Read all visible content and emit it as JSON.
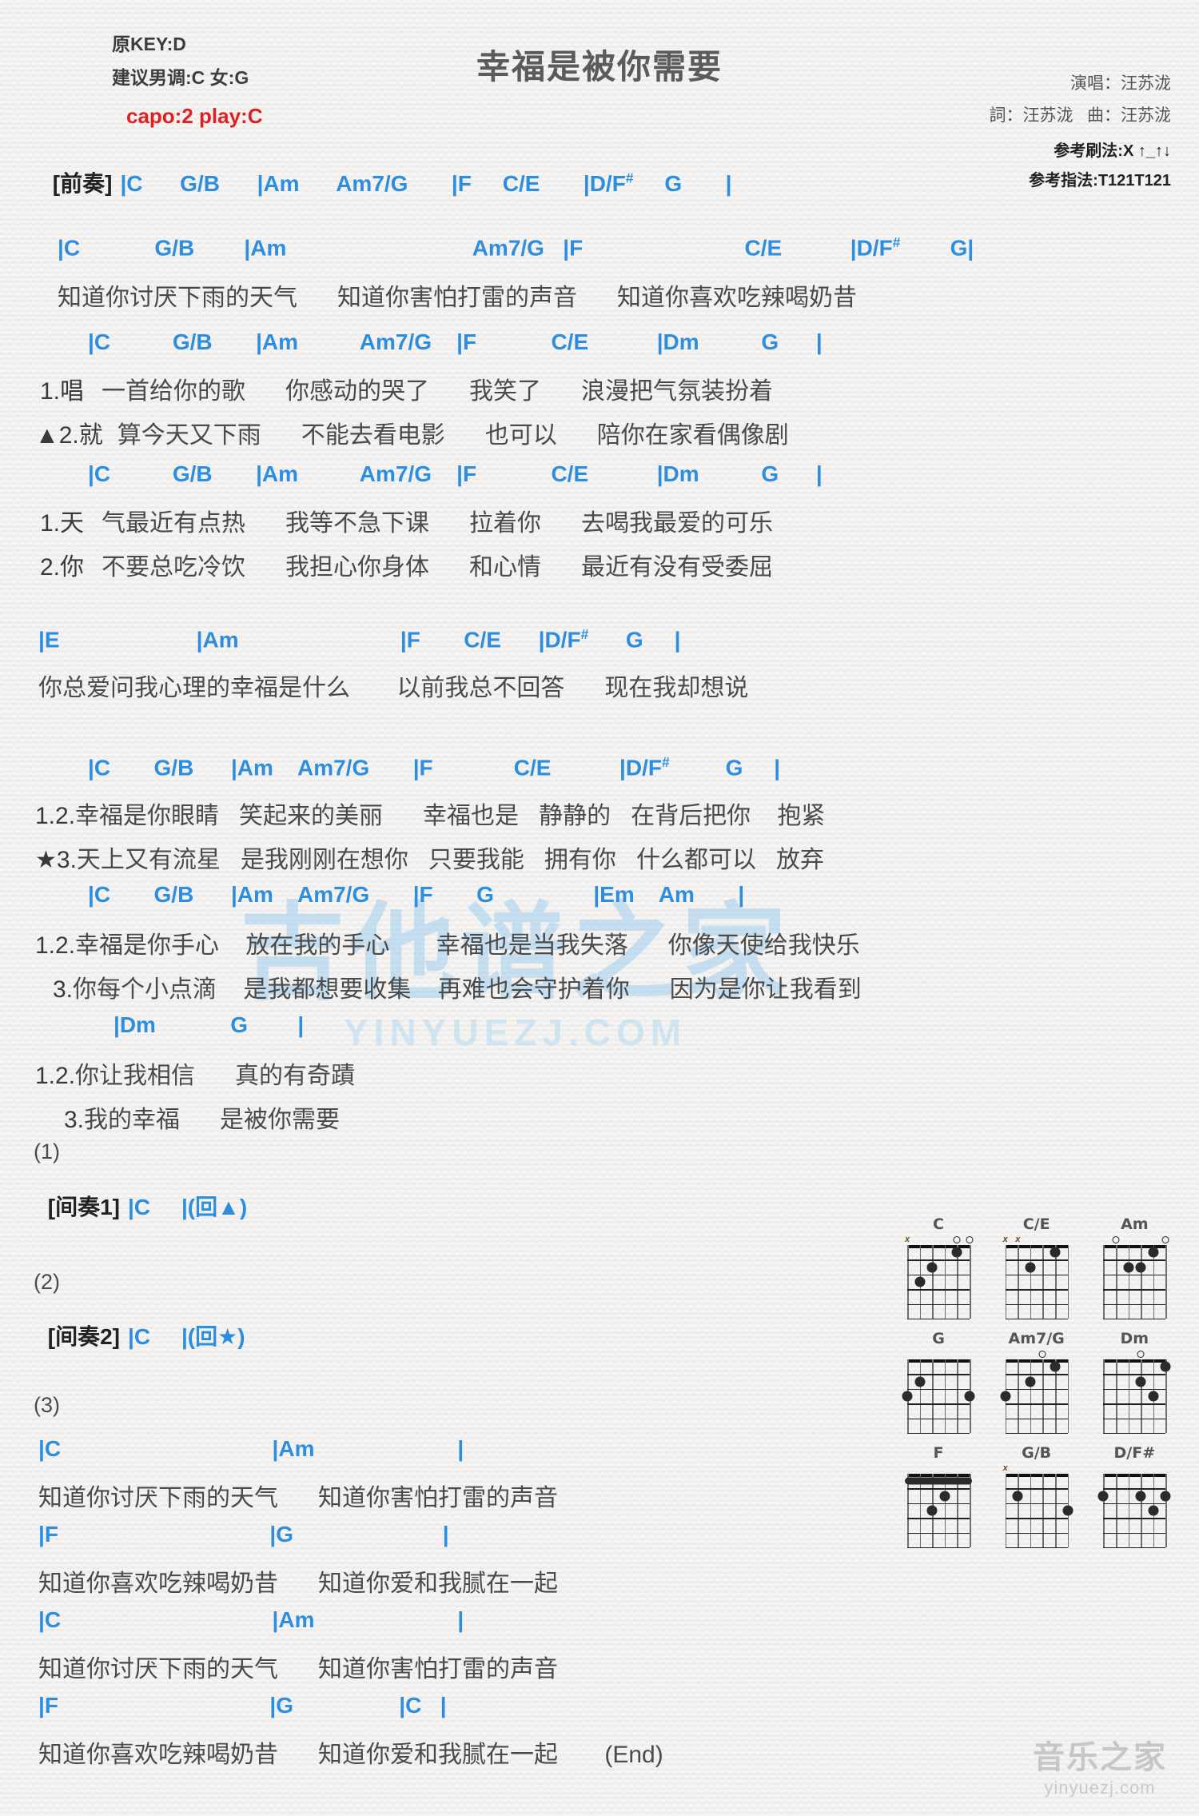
{
  "header": {
    "title": "幸福是被你需要",
    "original_key": "原KEY:D",
    "suggested_key": "建议男调:C 女:G",
    "capo": "capo:2 play:C",
    "singer": "演唱：汪苏泷",
    "writer": "詞：汪苏泷   曲：汪苏泷",
    "strumming": "参考刷法:X ↑_↑↓",
    "fingering": "参考指法:T121T121",
    "colors": {
      "chord": "#2d8ddf",
      "accent_red": "#e02020",
      "lyric": "#4a4a4a"
    }
  },
  "prelude": {
    "label": "[前奏]",
    "chords": "|C      G/B      |Am      Am7/G       |F     C/E       |D/F#     G       |"
  },
  "sections": [
    {
      "name": "verse-intro",
      "chord_line": "|C            G/B        |Am                              Am7/G   |F                          C/E           |D/F#        G|",
      "lyric_lines": [
        {
          "prefix": "",
          "text": "知道你讨厌下雨的天气      知道你害怕打雷的声音      知道你喜欢吃辣喝奶昔"
        }
      ]
    },
    {
      "name": "verse-1a",
      "chord_line": "|C          G/B       |Am          Am7/G    |F            C/E           |Dm          G      |",
      "lyric_lines": [
        {
          "prefix": "1.唱",
          "text": "一首给你的歌      你感动的哭了      我笑了      浪漫把气氛装扮着"
        },
        {
          "prefix": "▲2.就",
          "text": "算今天又下雨      不能去看电影      也可以      陪你在家看偶像剧"
        }
      ]
    },
    {
      "name": "verse-1b",
      "chord_line": "|C          G/B       |Am          Am7/G    |F            C/E           |Dm          G      |",
      "lyric_lines": [
        {
          "prefix": "1.天",
          "text": "气最近有点热      我等不急下课      拉着你      去喝我最爱的可乐"
        },
        {
          "prefix": "2.你",
          "text": "不要总吃冷饮      我担心你身体      和心情      最近有没有受委屈"
        }
      ]
    },
    {
      "name": "pre-chorus",
      "chord_line": "|E                      |Am                          |F       C/E      |D/F#      G     |",
      "lyric_lines": [
        {
          "prefix": "",
          "text": "你总爱问我心理的幸福是什么       以前我总不回答      现在我却想说"
        }
      ]
    },
    {
      "name": "chorus-1",
      "chord_line": "|C       G/B      |Am    Am7/G       |F             C/E           |D/F#         G     |",
      "lyric_lines": [
        {
          "prefix": "1.2.",
          "text": "幸福是你眼睛   笑起来的美丽      幸福也是   静静的   在背后把你    抱紧"
        },
        {
          "prefix": "★3.",
          "text": "天上又有流星   是我刚刚在想你   只要我能   拥有你   什么都可以   放弃"
        }
      ]
    },
    {
      "name": "chorus-2",
      "chord_line": "|C       G/B      |Am    Am7/G       |F       G                |Em    Am       |",
      "lyric_lines": [
        {
          "prefix": "1.2.",
          "text": "幸福是你手心    放在我的手心       幸福也是当我失落      你像天使给我快乐"
        },
        {
          "prefix": "3.",
          "text": "你每个小点滴    是我都想要收集    再难也会守护着你      因为是你让我看到"
        }
      ]
    },
    {
      "name": "chorus-tag",
      "chord_line": "|Dm            G        |",
      "lyric_lines": [
        {
          "prefix": "1.2.",
          "text": "你让我相信      真的有奇蹟"
        },
        {
          "prefix": "3.",
          "text": "我的幸福      是被你需要"
        }
      ]
    }
  ],
  "interludes": [
    {
      "marker": "(1)",
      "label": "[间奏1]",
      "chords": "|C     |(回▲)"
    },
    {
      "marker": "(2)",
      "label": "[间奏2]",
      "chords": "|C     |(回★)"
    },
    {
      "marker": "(3)",
      "label": "",
      "chords": ""
    }
  ],
  "outro": [
    {
      "chord_line": "|C                                  |Am                       |",
      "lyric": "知道你讨厌下雨的天气      知道你害怕打雷的声音"
    },
    {
      "chord_line": "|F                                  |G                        |",
      "lyric": "知道你喜欢吃辣喝奶昔      知道你爱和我腻在一起"
    },
    {
      "chord_line": "|C                                  |Am                       |",
      "lyric": "知道你讨厌下雨的天气      知道你害怕打雷的声音"
    },
    {
      "chord_line": "|F                                  |G                 |C   |",
      "lyric": "知道你喜欢吃辣喝奶昔      知道你爱和我腻在一起       (End)"
    }
  ],
  "chord_diagrams": [
    {
      "name": "C",
      "markers": [
        "x",
        "",
        "",
        "",
        "o",
        "o"
      ],
      "dots": [
        [
          5,
          3
        ],
        [
          4,
          2
        ],
        [
          2,
          1
        ]
      ],
      "barre": null
    },
    {
      "name": "C/E",
      "markers": [
        "x",
        "x",
        "",
        "",
        "",
        ""
      ],
      "dots": [
        [
          4,
          2
        ],
        [
          2,
          1
        ]
      ],
      "barre": null
    },
    {
      "name": "Am",
      "markers": [
        "",
        "o",
        "",
        "",
        "",
        "o"
      ],
      "dots": [
        [
          4,
          2
        ],
        [
          3,
          2
        ],
        [
          2,
          1
        ]
      ],
      "barre": null
    },
    {
      "name": "G",
      "markers": [
        "",
        "",
        "",
        "",
        "",
        ""
      ],
      "dots": [
        [
          6,
          3
        ],
        [
          5,
          2
        ],
        [
          1,
          3
        ]
      ],
      "barre": null
    },
    {
      "name": "Am7/G",
      "markers": [
        "",
        "",
        "",
        "o",
        "",
        ""
      ],
      "dots": [
        [
          6,
          3
        ],
        [
          4,
          2
        ],
        [
          2,
          1
        ]
      ],
      "barre": null
    },
    {
      "name": "Dm",
      "markers": [
        "",
        "",
        "",
        "o",
        "",
        ""
      ],
      "dots": [
        [
          3,
          2
        ],
        [
          2,
          3
        ],
        [
          1,
          1
        ]
      ],
      "barre": null
    },
    {
      "name": "F",
      "markers": [
        "",
        "",
        "",
        "",
        "",
        ""
      ],
      "dots": [
        [
          4,
          3
        ],
        [
          3,
          2
        ]
      ],
      "barre": 1
    },
    {
      "name": "G/B",
      "markers": [
        "x",
        "",
        "",
        "",
        "",
        ""
      ],
      "dots": [
        [
          5,
          2
        ],
        [
          1,
          3
        ]
      ],
      "barre": null
    },
    {
      "name": "D/F#",
      "markers": [
        "",
        "",
        "",
        "",
        "",
        ""
      ],
      "dots": [
        [
          6,
          2
        ],
        [
          3,
          2
        ],
        [
          2,
          3
        ],
        [
          1,
          2
        ]
      ],
      "barre": null
    }
  ],
  "watermark": {
    "center_big": "吉他谱之家",
    "center_small": "YINYUEZJ.COM",
    "corner_top": "音乐之家",
    "corner_bottom": "yinyuezj.com"
  }
}
